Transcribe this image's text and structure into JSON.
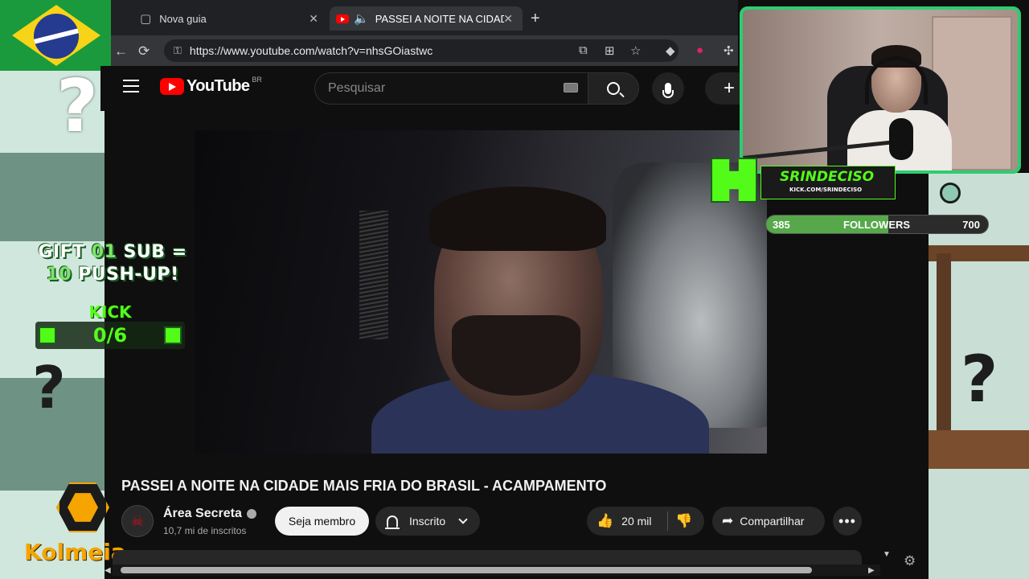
{
  "browser": {
    "tabs": [
      {
        "label": "Nova guia",
        "icon": "new-tab-icon",
        "active": false
      },
      {
        "label": "PASSEI A NOITE NA CIDADE",
        "icon": "youtube-icon",
        "active": true
      }
    ],
    "url": "https://www.youtube.com/watch?v=nhsGOiastwc",
    "new_tab_glyph": "+"
  },
  "youtube": {
    "logo_text": "YouTube",
    "country_code": "BR",
    "search_placeholder": "Pesquisar",
    "create_glyph": "+"
  },
  "video": {
    "title": "PASSEI A NOITE NA CIDADE MAIS FRIA DO BRASIL - ACAMPAMENTO",
    "channel_name": "Área Secreta",
    "subscribers": "10,7 mi de inscritos",
    "member_button": "Seja membro",
    "subscribed_button": "Inscrito",
    "likes": "20 mil",
    "share_button": "Compartilhar",
    "more_glyph": "•••"
  },
  "overlay": {
    "sub_goal_gift": "GIFT",
    "sub_goal_count": "01",
    "sub_goal_sub": "SUB",
    "sub_goal_equals": "=",
    "sub_goal_reps": "10",
    "sub_goal_pushup": "PUSH-UP",
    "sub_goal_bang": "!",
    "kick_label": "KICK",
    "kick_progress": "0/6",
    "brand_logo": "Kolmeia",
    "streamer_name": "SRINDECISO",
    "streamer_link": "KICK.COM/SRINDECISO",
    "followers_current": "385",
    "followers_label": "FOLLOWERS",
    "followers_goal": "700",
    "followers_fraction": 0.55
  },
  "colors": {
    "youtube_red": "#ff0000",
    "kick_green": "#53fc18",
    "webcam_border": "#2ecc71",
    "kolmeia_orange": "#f5a400"
  }
}
